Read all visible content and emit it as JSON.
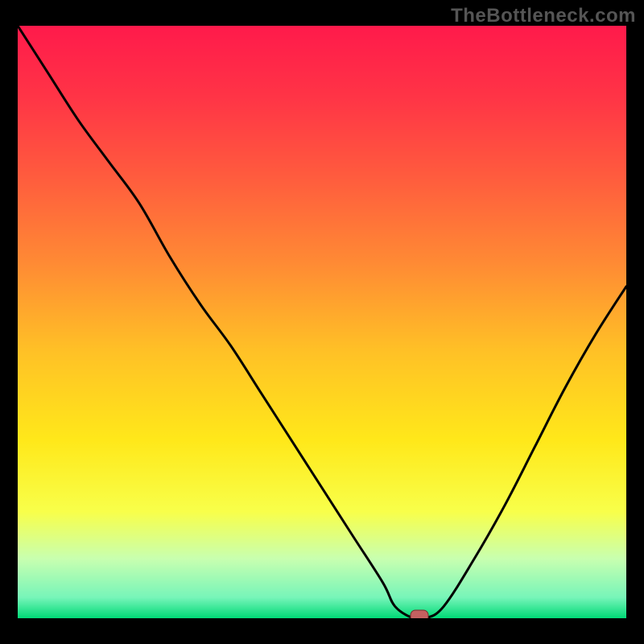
{
  "watermark": "TheBottleneck.com",
  "chart_data": {
    "type": "line",
    "title": "",
    "xlabel": "",
    "ylabel": "",
    "xlim": [
      0,
      100
    ],
    "ylim": [
      0,
      100
    ],
    "grid": false,
    "series": [
      {
        "name": "curve",
        "x": [
          0,
          5,
          10,
          15,
          20,
          25,
          30,
          35,
          40,
          45,
          50,
          55,
          60,
          62,
          65,
          67,
          70,
          75,
          80,
          85,
          90,
          95,
          100
        ],
        "y": [
          100,
          92,
          84,
          77,
          70,
          61,
          53,
          46,
          38,
          30,
          22,
          14,
          6,
          2,
          0,
          0,
          2,
          10,
          19,
          29,
          39,
          48,
          56
        ]
      }
    ],
    "marker": {
      "x": 66,
      "y": 0
    },
    "gradient_stops": [
      {
        "offset": 0.0,
        "color": "#ff1a4b"
      },
      {
        "offset": 0.12,
        "color": "#ff3446"
      },
      {
        "offset": 0.25,
        "color": "#ff5a3e"
      },
      {
        "offset": 0.4,
        "color": "#ff8a34"
      },
      {
        "offset": 0.55,
        "color": "#ffc126"
      },
      {
        "offset": 0.7,
        "color": "#ffe81a"
      },
      {
        "offset": 0.82,
        "color": "#f8ff4a"
      },
      {
        "offset": 0.9,
        "color": "#c8ffb0"
      },
      {
        "offset": 0.965,
        "color": "#77f5b9"
      },
      {
        "offset": 1.0,
        "color": "#00d976"
      }
    ],
    "marker_color": "#c46060"
  }
}
